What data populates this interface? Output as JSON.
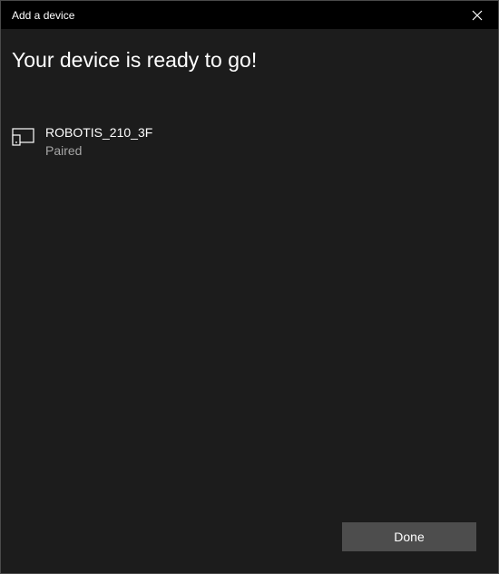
{
  "window": {
    "title": "Add a device"
  },
  "main": {
    "heading": "Your device is ready to go!",
    "devices": [
      {
        "name": "ROBOTIS_210_3F",
        "status": "Paired",
        "icon": "device-generic-icon"
      }
    ]
  },
  "footer": {
    "done_label": "Done"
  },
  "colors": {
    "titlebar_bg": "#000000",
    "content_bg": "#1c1c1c",
    "button_bg": "#4d4d4d",
    "secondary_text": "#a6a6a6"
  }
}
